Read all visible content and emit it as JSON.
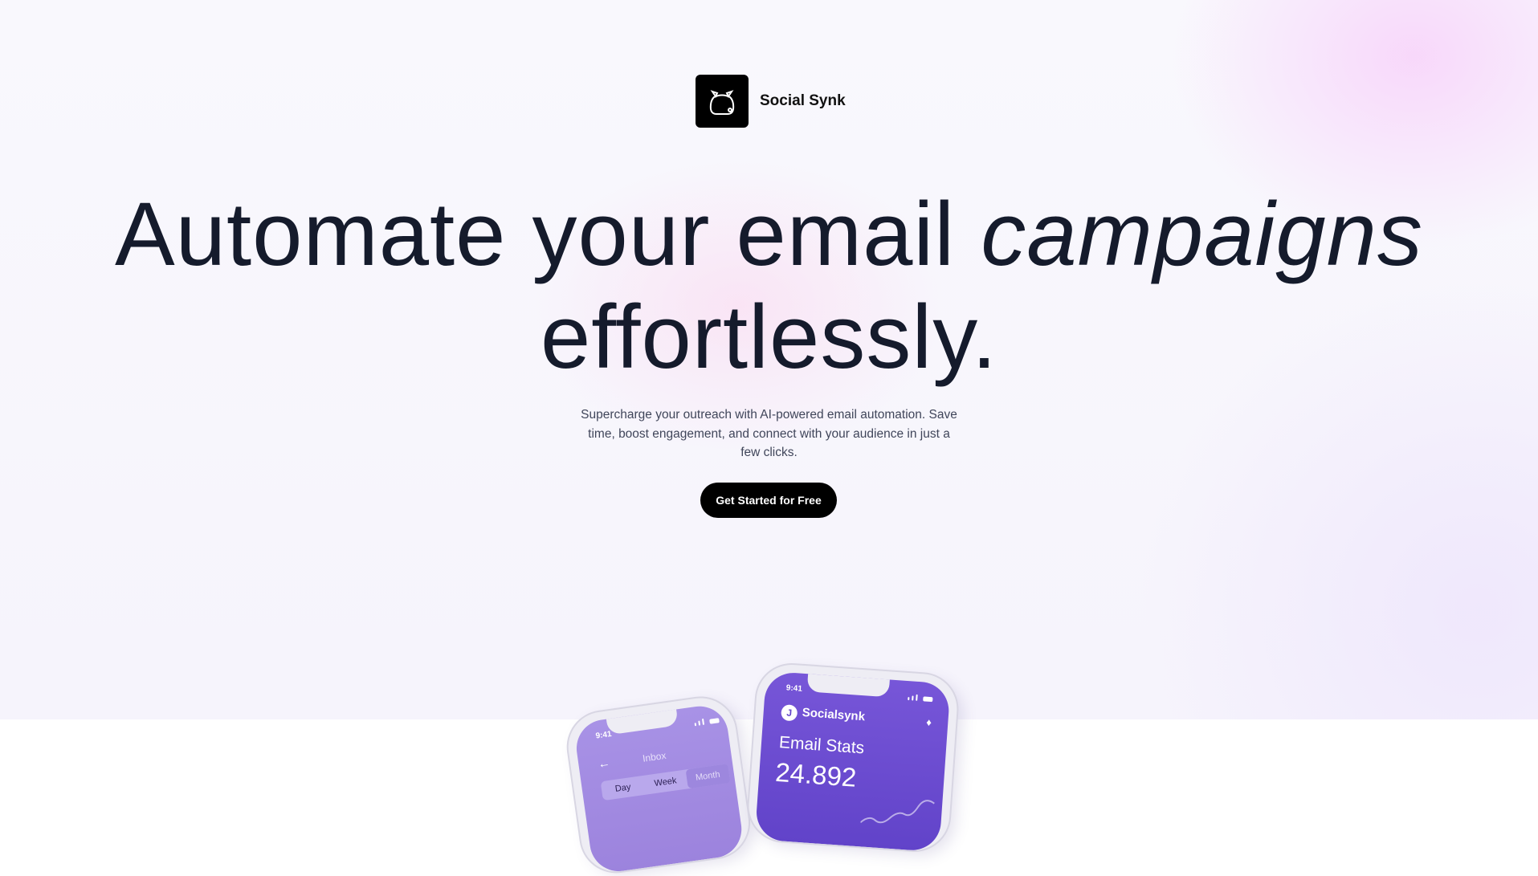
{
  "brand": {
    "name": "Social Synk",
    "logo_icon": "pouch-icon"
  },
  "hero": {
    "headline_part1": "Automate your email ",
    "headline_italic": "campaigns",
    "headline_part2": "effortlessly.",
    "subtitle": "Supercharge your outreach with AI-powered email automation. Save time, boost engagement, and connect with your audience in just a few clicks.",
    "cta_label": "Get Started for Free"
  },
  "phone_back": {
    "time": "9:41",
    "title": "Inbox",
    "segments": [
      "Day",
      "Week",
      "Month"
    ],
    "active_segment": "Month"
  },
  "phone_front": {
    "time": "9:41",
    "app_name": "Socialsynk",
    "card_title": "Email Stats",
    "card_value": "24.892"
  },
  "colors": {
    "text_dark": "#141a2b",
    "cta_bg": "#000000",
    "phone_purple": "#6143c9",
    "phone_lilac": "#a892e6"
  }
}
